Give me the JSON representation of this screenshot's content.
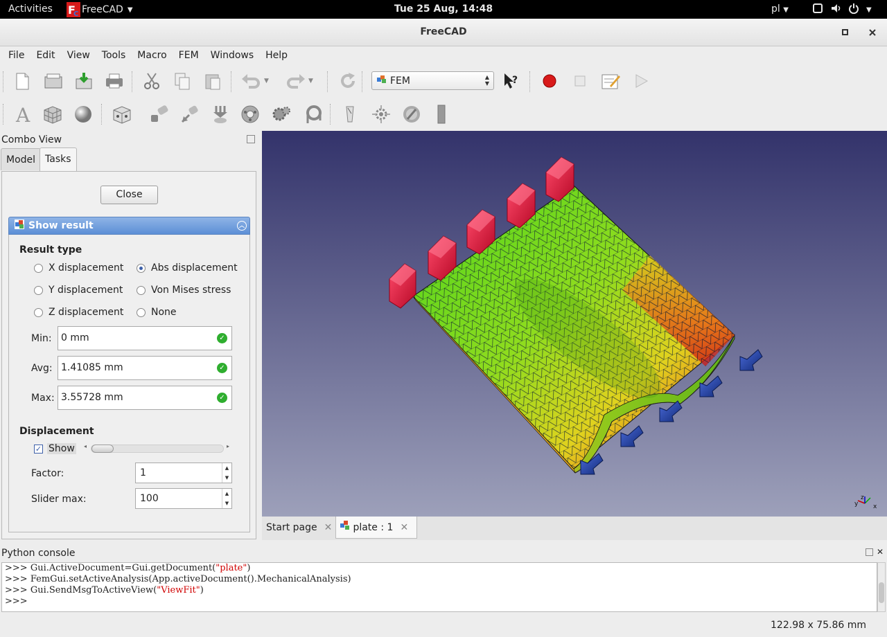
{
  "topbar": {
    "activities": "Activities",
    "app_name": "FreeCAD",
    "clock": "Tue 25 Aug, 14:48",
    "language": "pl"
  },
  "window": {
    "title": "FreeCAD"
  },
  "menubar": {
    "items": [
      "File",
      "Edit",
      "View",
      "Tools",
      "Macro",
      "FEM",
      "Windows",
      "Help"
    ]
  },
  "toolbar": {
    "workbench": "FEM"
  },
  "combo": {
    "title": "Combo View",
    "tabs": [
      "Model",
      "Tasks"
    ],
    "close_label": "Close",
    "panel_title": "Show result",
    "result_type_label": "Result type",
    "radios": {
      "x_disp": "X displacement",
      "abs_disp": "Abs displacement",
      "y_disp": "Y displacement",
      "von_mises": "Von Mises stress",
      "z_disp": "Z displacement",
      "none": "None"
    },
    "selected_radio": "Abs displacement",
    "min_label": "Min:",
    "min_value": "0 mm",
    "avg_label": "Avg:",
    "avg_value": "1.41085 mm",
    "max_label": "Max:",
    "max_value": "3.55728 mm",
    "displacement_label": "Displacement",
    "show_label": "Show",
    "show_checked": true,
    "factor_label": "Factor:",
    "factor_value": "1",
    "slider_max_label": "Slider max:",
    "slider_max_value": "100"
  },
  "doc_tabs": [
    "Start page",
    "plate : 1"
  ],
  "python_console": {
    "title": "Python console",
    "lines": [
      {
        "prompt": ">>> ",
        "pre": "Gui.ActiveDocument=Gui.getDocument(",
        "str": "\"plate\"",
        "post": ")"
      },
      {
        "prompt": ">>> ",
        "pre": "FemGui.setActiveAnalysis(App.activeDocument().MechanicalAnalysis)",
        "str": "",
        "post": ""
      },
      {
        "prompt": ">>> ",
        "pre": "Gui.SendMsgToActiveView(",
        "str": "\"ViewFit\"",
        "post": ")"
      },
      {
        "prompt": ">>> ",
        "pre": "",
        "str": "",
        "post": ""
      }
    ]
  },
  "status": {
    "dimensions": "122.98 x 75.86 mm"
  },
  "colors": {
    "panel_header": "#5c8fd6",
    "view_bg_top": "#33336b",
    "view_bg_bottom": "#9da0ba",
    "constraint_fixed": "#d8143c",
    "constraint_force": "#1d3fa0"
  }
}
